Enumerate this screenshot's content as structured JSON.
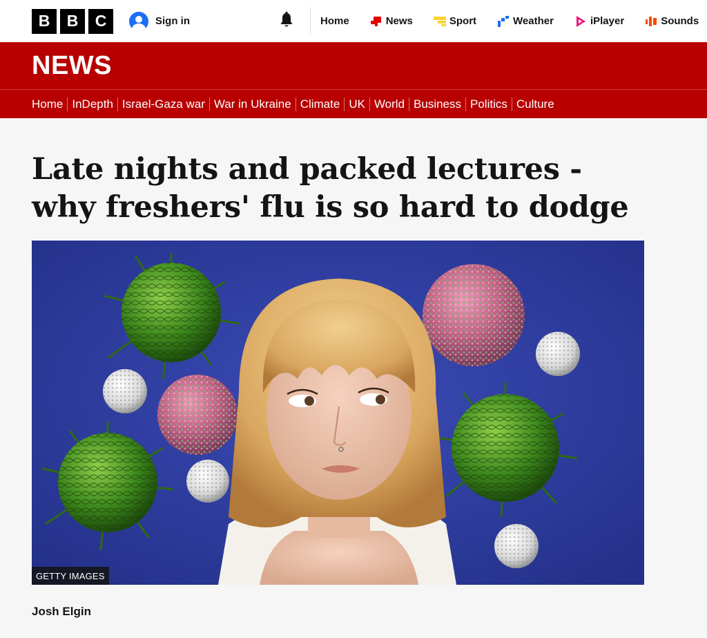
{
  "brand": {
    "letters": [
      "B",
      "B",
      "C"
    ]
  },
  "account": {
    "signin_label": "Sign in"
  },
  "topnav": [
    {
      "label": "Home",
      "icon": "none"
    },
    {
      "label": "News",
      "icon": "news-icon",
      "color": "#e50000"
    },
    {
      "label": "Sport",
      "icon": "sport-icon",
      "color": "#ffd230"
    },
    {
      "label": "Weather",
      "icon": "weather-icon",
      "color": "#1e6ef5"
    },
    {
      "label": "iPlayer",
      "icon": "iplayer-icon",
      "color": "#e8177a"
    },
    {
      "label": "Sounds",
      "icon": "sounds-icon",
      "color": "#ff4800"
    }
  ],
  "news_banner": {
    "title": "NEWS",
    "color": "#b80000"
  },
  "sections": [
    "Home",
    "InDepth",
    "Israel-Gaza war",
    "War in Ukraine",
    "Climate",
    "UK",
    "World",
    "Business",
    "Politics",
    "Culture"
  ],
  "article": {
    "headline": "Late nights and packed lectures - why freshers' flu is so hard to dodge",
    "image_credit": "GETTY IMAGES",
    "author": "Josh Elgin"
  }
}
